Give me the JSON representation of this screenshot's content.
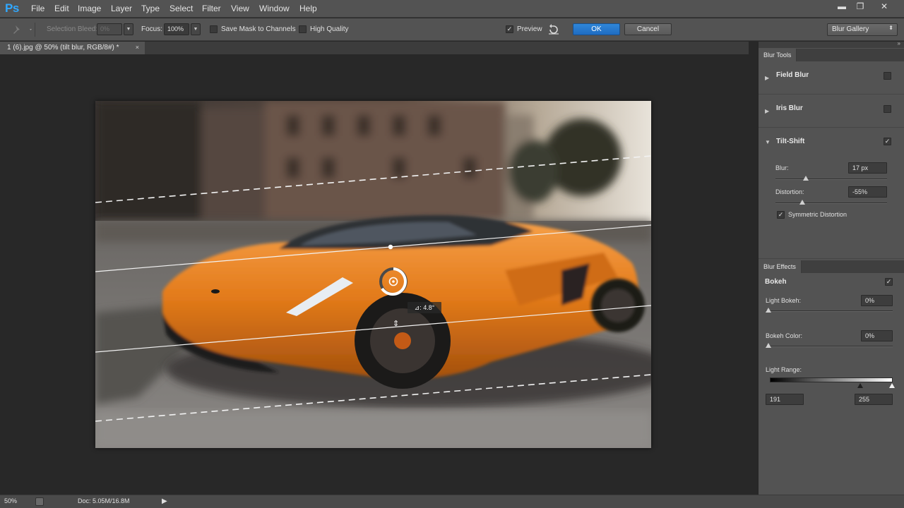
{
  "app": {
    "logo": "Ps"
  },
  "menu": [
    "File",
    "Edit",
    "Image",
    "Layer",
    "Type",
    "Select",
    "Filter",
    "View",
    "Window",
    "Help"
  ],
  "window_controls": {
    "minimize": "▬",
    "restore": "❐",
    "close": "✕"
  },
  "options": {
    "selection_bleed_label": "Selection Bleed:",
    "selection_bleed_value": "0%",
    "focus_label": "Focus:",
    "focus_value": "100%",
    "save_mask_label": "Save Mask to Channels",
    "save_mask_checked": false,
    "high_quality_label": "High Quality",
    "high_quality_checked": false,
    "preview_label": "Preview",
    "preview_checked": true,
    "ok_label": "OK",
    "cancel_label": "Cancel",
    "gallery_select_value": "Blur Gallery"
  },
  "document": {
    "tab_title": "1 (6).jpg @ 50% (tilt blur, RGB/8#) *",
    "close_symbol": "×"
  },
  "overlay": {
    "angle_readout": "⊿: 4.8°"
  },
  "status": {
    "zoom": "50%",
    "doc_size": "Doc: 5.05M/16.8M"
  },
  "blur_tools": {
    "panel_title": "Blur Tools",
    "field_blur": {
      "label": "Field Blur",
      "checked": false
    },
    "iris_blur": {
      "label": "Iris Blur",
      "checked": false
    },
    "tilt_shift": {
      "label": "Tilt-Shift",
      "checked": true,
      "blur_label": "Blur:",
      "blur_value": "17 px",
      "blur_slider": 0.34,
      "distortion_label": "Distortion:",
      "distortion_value": "-55%",
      "distortion_slider": 0.25,
      "symmetric_label": "Symmetric Distortion",
      "symmetric_checked": true
    }
  },
  "blur_effects": {
    "panel_title": "Blur Effects",
    "bokeh_label": "Bokeh",
    "bokeh_checked": true,
    "light_bokeh_label": "Light Bokeh:",
    "light_bokeh_value": "0%",
    "bokeh_color_label": "Bokeh Color:",
    "bokeh_color_value": "0%",
    "light_range_label": "Light Range:",
    "light_range_low": "191",
    "light_range_high": "255"
  },
  "colors": {
    "accent": "#1f6cc2",
    "panel": "#535353",
    "background": "#282828",
    "car": "#e07a1c"
  }
}
